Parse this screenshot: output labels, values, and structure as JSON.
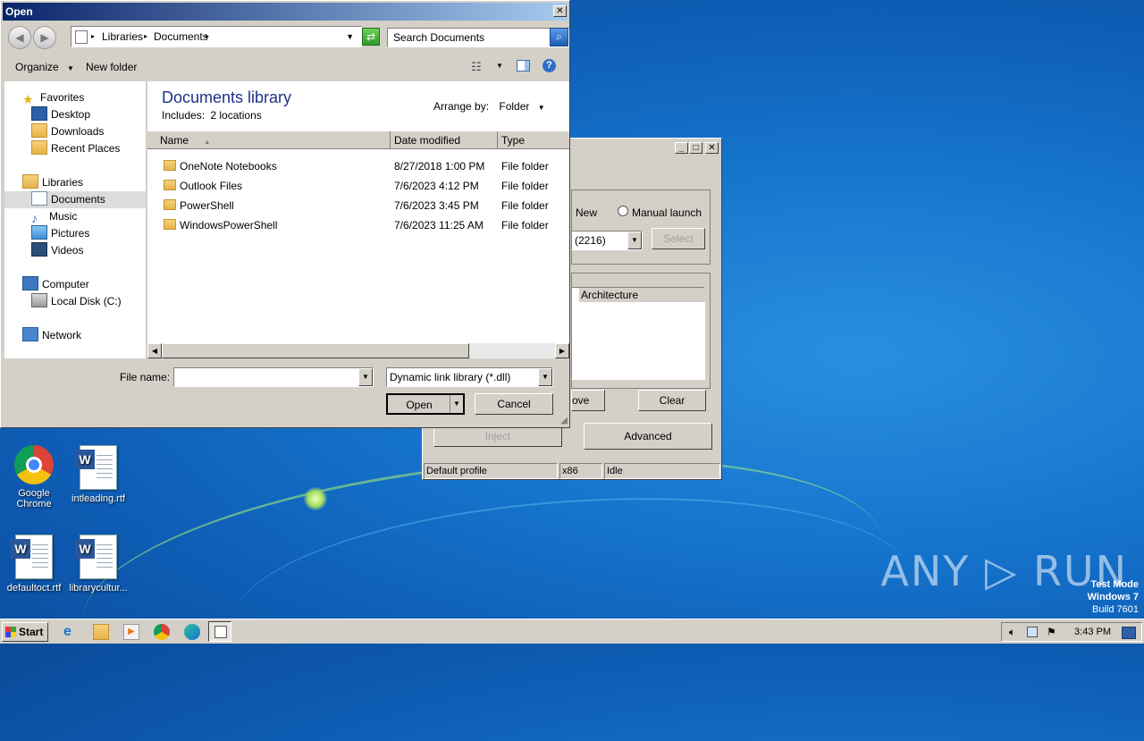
{
  "desktop": {
    "icons": [
      {
        "label": "Google Chrome"
      },
      {
        "label": "intleading.rtf"
      },
      {
        "label": "defaultoct.rtf"
      },
      {
        "label": "librarycultur..."
      }
    ],
    "watermark": "ANY ▷ RUN",
    "test_mode": {
      "line1": "Test Mode",
      "line2": "Windows 7",
      "line3": "Build 7601"
    }
  },
  "taskbar": {
    "start_label": "Start",
    "clock": "3:43 PM"
  },
  "injector": {
    "radio_new": "New",
    "radio_manual": "Manual launch",
    "process_value": "(2216)",
    "select_button": "Select",
    "col_architecture": "Architecture",
    "remove_button": "ove",
    "clear_button": "Clear",
    "inject_button": "Inject",
    "advanced_button": "Advanced",
    "status": {
      "profile": "Default profile",
      "arch": "x86",
      "state": "Idle"
    }
  },
  "open_dialog": {
    "title": "Open",
    "close_glyph": "✕",
    "breadcrumb": {
      "root": "Libraries",
      "current": "Documents"
    },
    "search_placeholder": "Search Documents",
    "organize_label": "Organize",
    "new_folder_label": "New folder",
    "nav": {
      "favorites": "Favorites",
      "desktop": "Desktop",
      "downloads": "Downloads",
      "recent": "Recent Places",
      "libraries": "Libraries",
      "documents": "Documents",
      "music": "Music",
      "pictures": "Pictures",
      "videos": "Videos",
      "computer": "Computer",
      "local_disk": "Local Disk (C:)",
      "network": "Network"
    },
    "library_title": "Documents library",
    "includes_label": "Includes:",
    "includes_link": "2 locations",
    "arrange_by_label": "Arrange by:",
    "arrange_by_value": "Folder",
    "columns": {
      "name": "Name",
      "date": "Date modified",
      "type": "Type"
    },
    "files": [
      {
        "name": "OneNote Notebooks",
        "date": "8/27/2018 1:00 PM",
        "type": "File folder"
      },
      {
        "name": "Outlook Files",
        "date": "7/6/2023 4:12 PM",
        "type": "File folder"
      },
      {
        "name": "PowerShell",
        "date": "7/6/2023 3:45 PM",
        "type": "File folder"
      },
      {
        "name": "WindowsPowerShell",
        "date": "7/6/2023 11:25 AM",
        "type": "File folder"
      }
    ],
    "file_name_label": "File name:",
    "file_name_value": "",
    "file_type_value": "Dynamic link library (*.dll)",
    "open_button": "Open",
    "cancel_button": "Cancel"
  }
}
